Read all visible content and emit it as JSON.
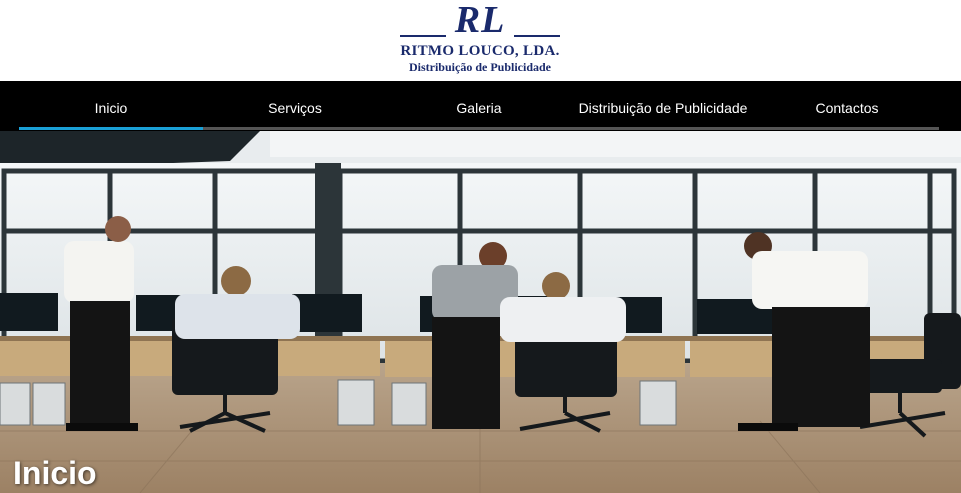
{
  "brand": {
    "initials": "RL",
    "name": "RITMO LOUCO, LDA.",
    "tagline": "Distribuição de Publicidade",
    "color": "#1a2a6c"
  },
  "nav": {
    "items": [
      {
        "label": "Inicio",
        "active": true
      },
      {
        "label": "Serviços",
        "active": false
      },
      {
        "label": "Galeria",
        "active": false
      },
      {
        "label": "Distribuição de Publicidade",
        "active": false
      },
      {
        "label": "Contactos",
        "active": false
      }
    ],
    "active_color": "#1aa0d6"
  },
  "hero": {
    "caption": "Inicio",
    "image": "office-photo"
  }
}
